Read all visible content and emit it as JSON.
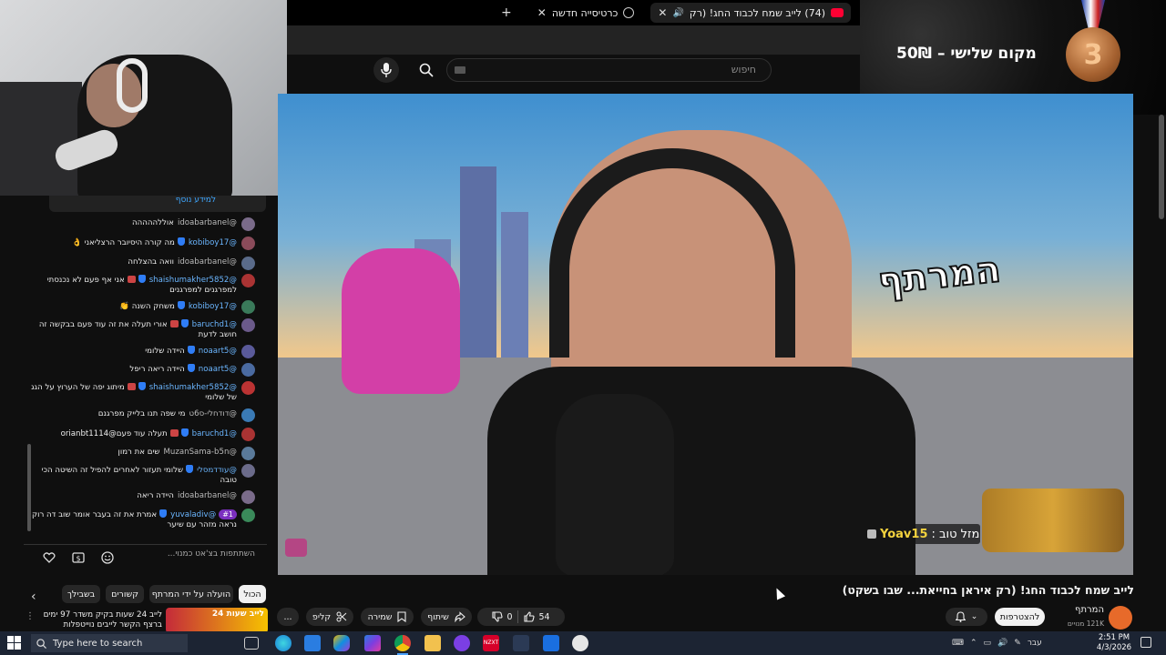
{
  "browser": {
    "tabs": [
      {
        "label": "(74) לייב שמח לכבוד החג! (רק",
        "active": true,
        "icon": "youtube-icon"
      },
      {
        "label": "כרטיסייה חדשה",
        "active": false,
        "icon": "chrome-icon"
      }
    ],
    "new_tab": "+"
  },
  "youtube": {
    "search_placeholder": "חיפוש"
  },
  "prize_overlay": {
    "text": "מקום שלישי – 50₪",
    "medal_number": "3"
  },
  "chat": {
    "peek_text": "למידע נוסף",
    "messages": [
      {
        "author": "@idoabarbanel",
        "text": "אוללההההה",
        "mod": false,
        "badges": 0
      },
      {
        "author": "@kobiboy17",
        "text": "מה קורה היסיובר הרצליאני 👌",
        "mod": true,
        "badges": 1
      },
      {
        "author": "@idoabarbanel",
        "text": "וואה בהצלחה",
        "mod": false,
        "badges": 0
      },
      {
        "author": "@shaishumakher5852",
        "text": "אני אף פעם לא נכנסתי למפרגנים למפרגנים",
        "mod": true,
        "badges": 2
      },
      {
        "author": "@kobiboy17",
        "text": "משחק השנה 👏",
        "mod": true,
        "badges": 1
      },
      {
        "author": "@baruchd1",
        "text": "אורי תעלה את זה עוד פעם בבקשה זה חושב לדעת",
        "mod": true,
        "badges": 2
      },
      {
        "author": "@noaart5",
        "text": "היידה שלומי",
        "mod": true,
        "badges": 1
      },
      {
        "author": "@noaart5",
        "text": "היידה ריאה ריפל",
        "mod": true,
        "badges": 1
      },
      {
        "author": "@shaishumakher5852",
        "text": "מיתוג יפה של הערוץ על הגג של שלומי",
        "mod": true,
        "badges": 2
      },
      {
        "author": "@דודחלי-ס6ט",
        "text": "מי שפה תנו בלייק מפרגנם",
        "mod": false,
        "badges": 0
      },
      {
        "author": "@baruchd1",
        "text": "תעלה עוד פעם@orianbt1114",
        "mod": true,
        "badges": 2
      },
      {
        "author": "@MuzanSama-b5n",
        "text": "שים את רמון",
        "mod": false,
        "badges": 0
      },
      {
        "author": "@עודדמסלי",
        "text": "שלומי תעזור לאחרים להפיל זה השיטה הכי טובה",
        "mod": true,
        "badges": 1
      },
      {
        "author": "@idoabarbanel",
        "text": "היידה ריאה",
        "mod": false,
        "badges": 0
      },
      {
        "author": "@yuvaladiv",
        "text": "אמרת את זה בעבר אומר שוב דה רוק נראה מזהר עם שיער",
        "mod": true,
        "badges": 1,
        "member": "#1"
      }
    ],
    "input_placeholder": "השתתפות בצ'אט כמנוי..."
  },
  "video": {
    "channel_logo_text": "המרתף",
    "donation_user": "Yoav15",
    "donation_text": "מזל טוב :",
    "title": "לייב שמח לכבוד החג! (רק איראן בחייאת... שבו בשקט)"
  },
  "channel": {
    "name": "המרתף",
    "subs": "121K מנויים",
    "join_label": "להצטרפות"
  },
  "actions": {
    "likes": "54",
    "dislikes": "0",
    "share": "שיתוף",
    "save": "שמירה",
    "clip": "קליפ",
    "more": "..."
  },
  "filters": {
    "chips": [
      "הכול",
      "הועלה על ידי המרתף",
      "קשורים",
      "בשבילך"
    ],
    "selected": 0
  },
  "recommended": {
    "title": "לייב 24 שעות בקיק משדר 97 ימים ברצף הקשר לייבים נוייטפלות",
    "thumb_tag": "לייב שעות 24"
  },
  "taskbar": {
    "search_placeholder": "Type here to search",
    "language": "עבר",
    "time": "2:51 PM",
    "date": "4/3/2026"
  },
  "colors": {
    "yt_red": "#ff0033",
    "accent_blue": "#3ea6ff",
    "donation_name": "#f3d23e"
  }
}
